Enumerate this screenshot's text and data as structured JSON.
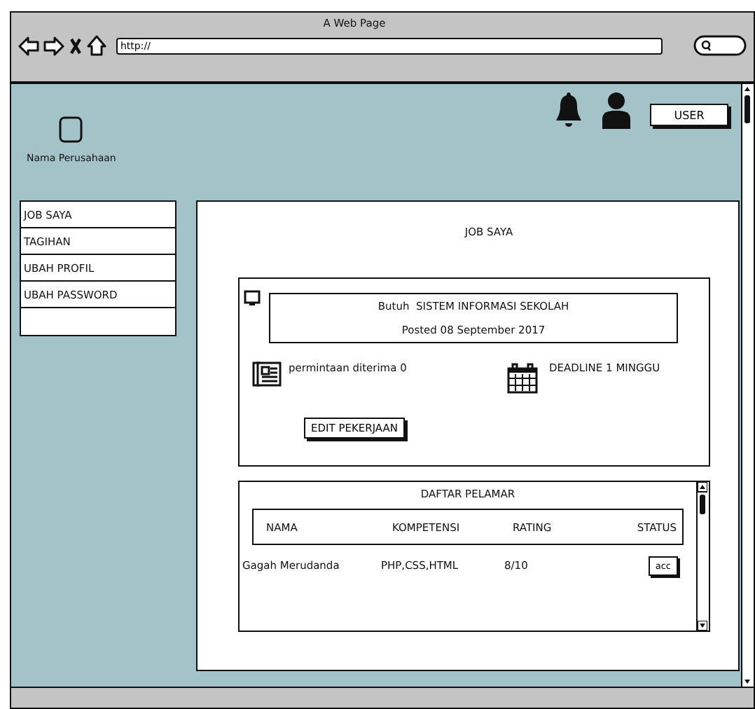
{
  "browser": {
    "title": "A Web Page",
    "url": "http://"
  },
  "header": {
    "company": "Nama Perusahaan",
    "user_button": "USER"
  },
  "sidebar": {
    "items": [
      {
        "label": "JOB SAYA"
      },
      {
        "label": "TAGIHAN"
      },
      {
        "label": "UBAH PROFIL"
      },
      {
        "label": "UBAH PASSWORD"
      }
    ]
  },
  "main": {
    "title": "JOB SAYA",
    "job": {
      "need": "Butuh  SISTEM INFORMASI SEKOLAH",
      "posted": "Posted 08 September 2017",
      "requests": "permintaan diterima 0",
      "deadline": "DEADLINE 1 MINGGU",
      "edit_button": "EDIT PEKERJAAN"
    },
    "applicants": {
      "title": "DAFTAR PELAMAR",
      "columns": [
        "NAMA",
        "KOMPETENSI",
        "RATING",
        "STATUS"
      ],
      "rows": [
        {
          "name": "Gagah Merudanda",
          "skills": "PHP,CSS,HTML",
          "rating": "8/10",
          "action": "acc"
        }
      ]
    }
  }
}
